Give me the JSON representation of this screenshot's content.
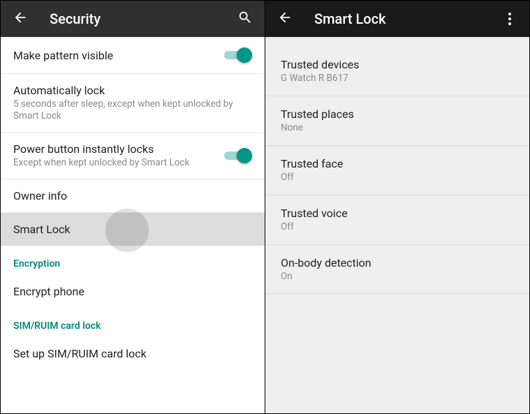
{
  "left": {
    "title": "Security",
    "items": [
      {
        "primary": "Make pattern visible",
        "toggle": true
      },
      {
        "primary": "Automatically lock",
        "secondary": "5 seconds after sleep, except when kept unlocked by Smart Lock"
      },
      {
        "primary": "Power button instantly locks",
        "secondary": "Except when kept unlocked by Smart Lock",
        "toggle": true
      },
      {
        "primary": "Owner info"
      },
      {
        "primary": "Smart Lock",
        "selected": true
      }
    ],
    "section1": "Encryption",
    "encrypt": "Encrypt phone",
    "section2": "SIM/RUIM card lock",
    "sim": "Set up SIM/RUIM card lock"
  },
  "right": {
    "title": "Smart Lock",
    "items": [
      {
        "primary": "Trusted devices",
        "secondary": "G Watch R B617"
      },
      {
        "primary": "Trusted places",
        "secondary": "None"
      },
      {
        "primary": "Trusted face",
        "secondary": "Off"
      },
      {
        "primary": "Trusted voice",
        "secondary": "Off"
      },
      {
        "primary": "On-body detection",
        "secondary": "On"
      }
    ]
  }
}
